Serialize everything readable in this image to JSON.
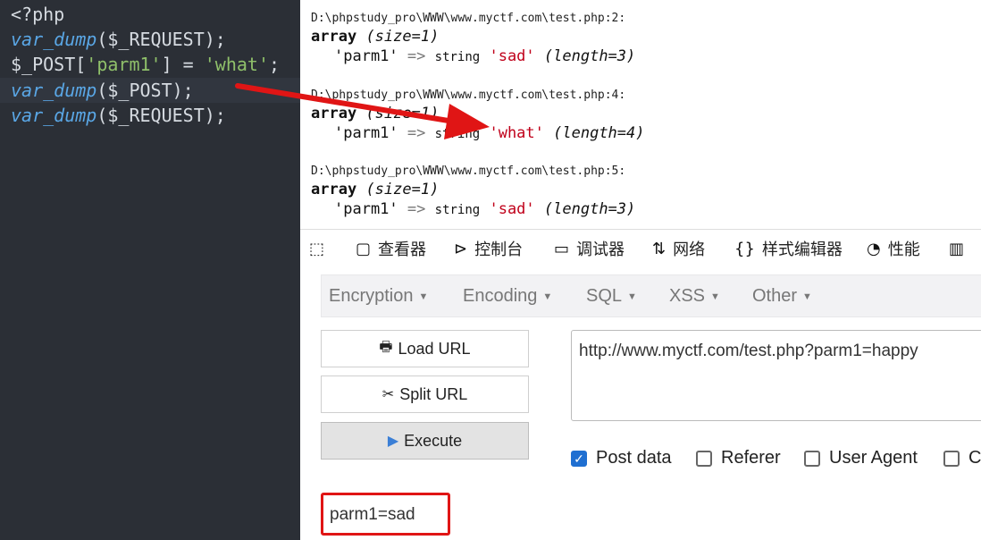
{
  "editor": {
    "lines": [
      {
        "segments": [
          {
            "t": "<?php",
            "c": "op"
          }
        ]
      },
      {
        "segments": [
          {
            "t": "var_dump",
            "c": "fn"
          },
          {
            "t": "($_REQUEST);",
            "c": "var"
          }
        ]
      },
      {
        "segments": [
          {
            "t": "$_POST[",
            "c": "var"
          },
          {
            "t": "'parm1'",
            "c": "str"
          },
          {
            "t": "] = ",
            "c": "op"
          },
          {
            "t": "'what'",
            "c": "str"
          },
          {
            "t": ";",
            "c": "op"
          }
        ]
      },
      {
        "segments": [
          {
            "t": "var_dump",
            "c": "fn"
          },
          {
            "t": "($_POST);",
            "c": "var"
          }
        ]
      },
      {
        "segments": [
          {
            "t": "var_dump",
            "c": "fn"
          },
          {
            "t": "($_REQUEST);",
            "c": "var"
          }
        ]
      }
    ]
  },
  "output": {
    "dumps": [
      {
        "path": "D:\\phpstudy_pro\\WWW\\www.myctf.com\\test.php:2:",
        "array_kw": "array",
        "size": "(size=1)",
        "key": "'parm1'",
        "arrow": "=>",
        "type": "string",
        "value": "'sad'",
        "length": "(length=3)"
      },
      {
        "path": "D:\\phpstudy_pro\\WWW\\www.myctf.com\\test.php:4:",
        "array_kw": "array",
        "size": "(size=1)",
        "key": "'parm1'",
        "arrow": "=>",
        "type": "string",
        "value": "'what'",
        "length": "(length=4)"
      },
      {
        "path": "D:\\phpstudy_pro\\WWW\\www.myctf.com\\test.php:5:",
        "array_kw": "array",
        "size": "(size=1)",
        "key": "'parm1'",
        "arrow": "=>",
        "type": "string",
        "value": "'sad'",
        "length": "(length=3)"
      }
    ]
  },
  "devtools": {
    "tabs": [
      {
        "label": "",
        "icon": "pick-element-icon"
      },
      {
        "label": "查看器",
        "icon": "inspector-icon"
      },
      {
        "label": "控制台",
        "icon": "console-icon"
      },
      {
        "label": "调试器",
        "icon": "debugger-icon"
      },
      {
        "label": "网络",
        "icon": "network-icon"
      },
      {
        "label": "样式编辑器",
        "icon": "style-editor-icon"
      },
      {
        "label": "性能",
        "icon": "performance-icon"
      }
    ]
  },
  "hackbar": {
    "menus": [
      "Encryption",
      "Encoding",
      "SQL",
      "XSS",
      "Other"
    ],
    "load_url": "Load URL",
    "split_url": "Split URL",
    "execute": "Execute",
    "url_value": "http://www.myctf.com/test.php?parm1=happy",
    "options": [
      {
        "label": "Post data",
        "checked": true
      },
      {
        "label": "Referer",
        "checked": false
      },
      {
        "label": "User Agent",
        "checked": false
      },
      {
        "label": "C",
        "checked": false
      }
    ],
    "post_value": "parm1=sad"
  },
  "colors": {
    "annotation": "#e01515",
    "editor_bg": "#2b2f36",
    "string_red": "#c0001a",
    "checkbox_blue": "#1f6fd1"
  }
}
